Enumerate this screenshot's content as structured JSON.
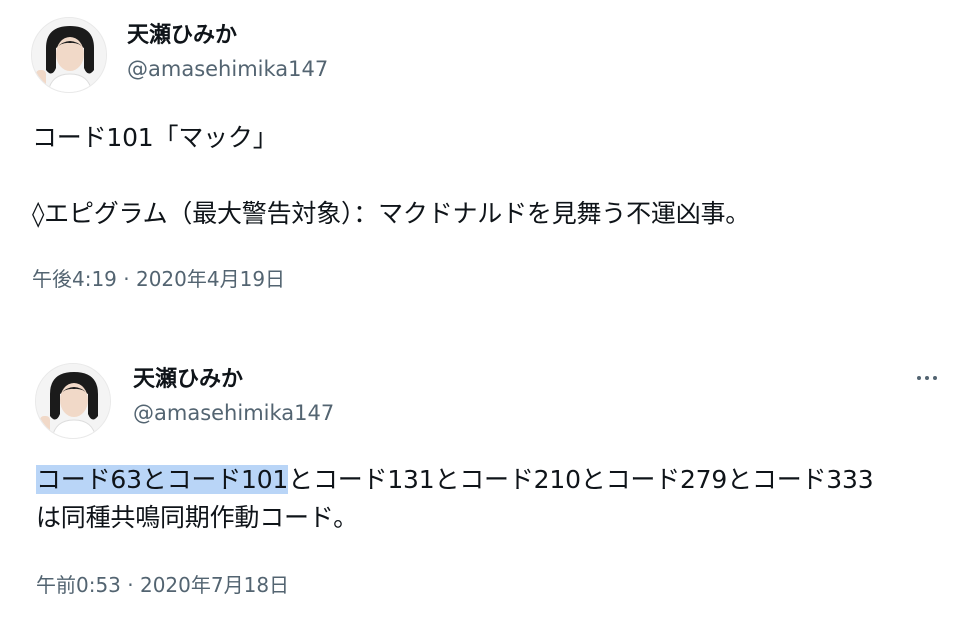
{
  "tweets": [
    {
      "display_name": "天瀬ひみか",
      "handle": "@amasehimika147",
      "text_line1": "コード101「マック」",
      "text_line2": "",
      "text_line3": "◊エピグラム（最大警告対象）：マクドナルドを見舞う不運凶事。",
      "timestamp": "午後4:19 · 2020年4月19日"
    },
    {
      "display_name": "天瀬ひみか",
      "handle": "@amasehimika147",
      "more_icon": "more-horizontal-icon",
      "text_highlighted": "コード63とコード101",
      "text_rest_line1": "とコード131とコード210とコード279とコード333",
      "text_line2": "は同種共鳴同期作動コード。",
      "timestamp": "午前0:53 · 2020年7月18日"
    }
  ],
  "colors": {
    "text": "#0f1419",
    "secondary": "#536471",
    "selection": "#b9d5f7"
  }
}
